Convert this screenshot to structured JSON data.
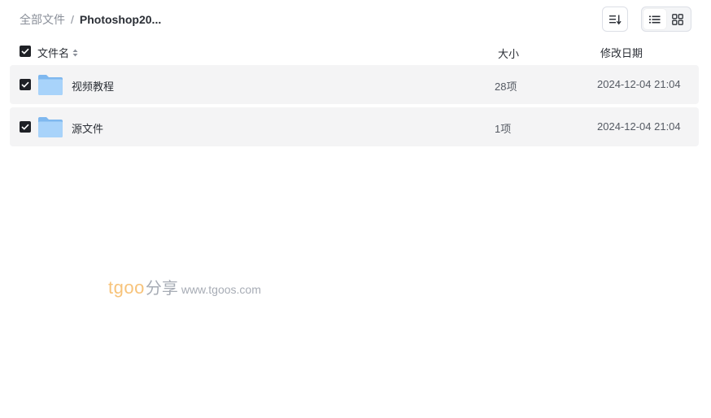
{
  "breadcrumb": {
    "root": "全部文件",
    "separator": "/",
    "current": "Photoshop20..."
  },
  "toolbar": {
    "sort_icon": "sort-list-icon",
    "view_list_icon": "list-view-icon",
    "view_grid_icon": "grid-view-icon",
    "active_view": "list"
  },
  "table": {
    "select_all_checked": true,
    "headers": {
      "name": "文件名",
      "size": "大小",
      "date": "修改日期"
    },
    "rows": [
      {
        "checked": true,
        "icon": "folder-icon",
        "name": "视频教程",
        "size": "28项",
        "date": "2024-12-04 21:04"
      },
      {
        "checked": true,
        "icon": "folder-icon",
        "name": "源文件",
        "size": "1项",
        "date": "2024-12-04 21:04"
      }
    ]
  },
  "watermark": {
    "brand": "tgoo",
    "suffix": "分享",
    "url": "www.tgoos.com"
  },
  "colors": {
    "row_background": "#f4f4f5",
    "checkbox": "#1f2126",
    "folder": "#8cc4f5",
    "watermark_brand": "#f7c37a"
  }
}
